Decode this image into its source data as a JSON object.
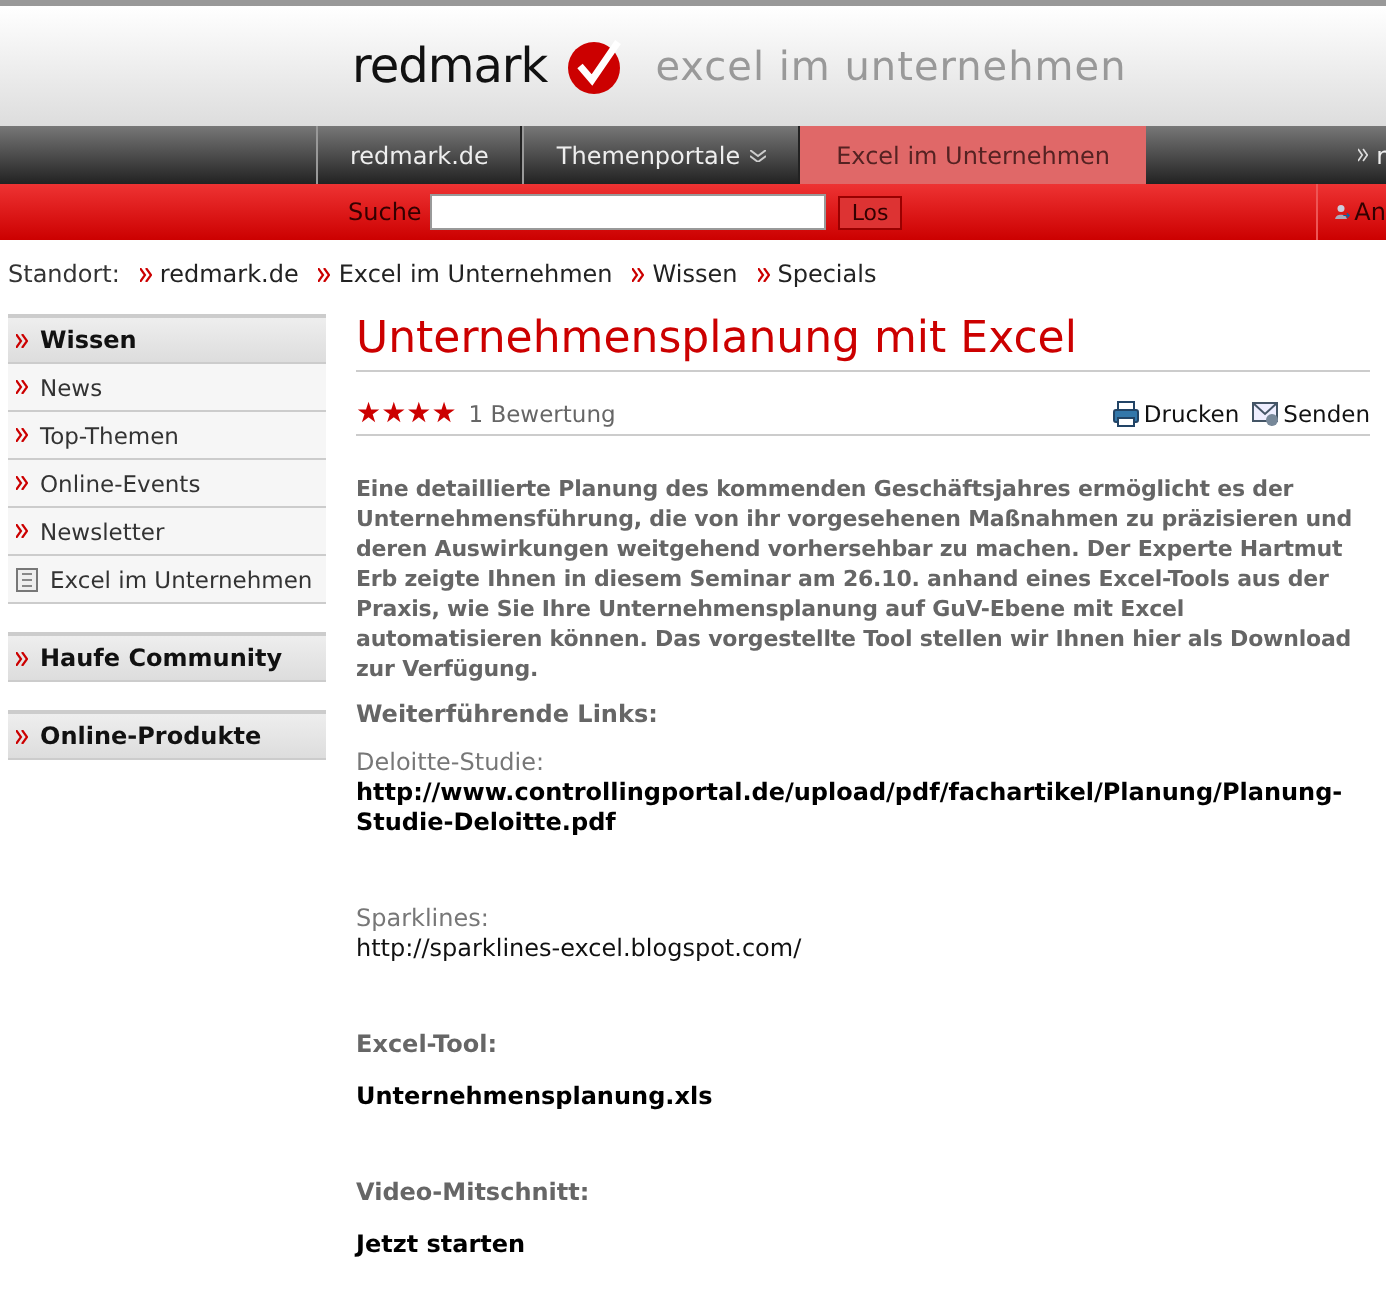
{
  "header": {
    "brand": "redmark",
    "tagline": "excel im unternehmen"
  },
  "nav": {
    "tabs": [
      {
        "label": "redmark.de",
        "selected": false,
        "dropdown": false
      },
      {
        "label": "Themenportale",
        "selected": false,
        "dropdown": true
      },
      {
        "label": "Excel im Unternehmen",
        "selected": true,
        "dropdown": false
      }
    ],
    "right_link": "r"
  },
  "search": {
    "label": "Suche",
    "button": "Los",
    "account_link": "An"
  },
  "breadcrumb": {
    "label": "Standort:",
    "items": [
      "redmark.de",
      "Excel im Unternehmen",
      "Wissen",
      "Specials"
    ]
  },
  "sidebar": [
    {
      "title": "Wissen",
      "items": [
        {
          "label": "News",
          "kind": "link"
        },
        {
          "label": "Top-Themen",
          "kind": "link"
        },
        {
          "label": "Online-Events",
          "kind": "link"
        },
        {
          "label": "Newsletter",
          "kind": "link"
        },
        {
          "label": "Excel im Unternehmen",
          "kind": "document"
        }
      ]
    },
    {
      "title": "Haufe Community"
    },
    {
      "title": "Online-Produkte"
    }
  ],
  "article": {
    "title": "Unternehmensplanung mit Excel",
    "stars": 4,
    "rating_count": "1 Bewertung",
    "print": "Drucken",
    "send": "Senden",
    "intro": "Eine detaillierte Planung des kommenden Geschäftsjahres ermöglicht es der Unternehmensführung, die von ihr vorgesehenen Maßnahmen zu präzisieren und deren Auswirkungen weitgehend vorhersehbar zu machen. Der Experte Hartmut Erb zeigte Ihnen in diesem Seminar am 26.10. anhand eines Excel-Tools aus der Praxis, wie Sie Ihre Unternehmensplanung auf GuV-Ebene mit Excel automatisieren können. Das vorgestellte Tool stellen wir Ihnen hier als Download zur Verfügung.",
    "links_heading": "Weiterführende Links:",
    "sections": [
      {
        "label": "Deloitte-Studie:",
        "label_bold": false,
        "link": "http://www.controllingportal.de/upload/pdf/fachartikel/Planung/Planung-Studie-Deloitte.pdf",
        "link_bold": true
      },
      {
        "label": "Sparklines:",
        "label_bold": false,
        "link": "http://sparklines-excel.blogspot.com/",
        "link_bold": false
      },
      {
        "label": "Excel-Tool:",
        "label_bold": true,
        "link": "Unternehmensplanung.xls",
        "link_bold": true
      },
      {
        "label": "Video-Mitschnitt:",
        "label_bold": true,
        "link": "Jetzt starten",
        "link_bold": true
      }
    ]
  }
}
